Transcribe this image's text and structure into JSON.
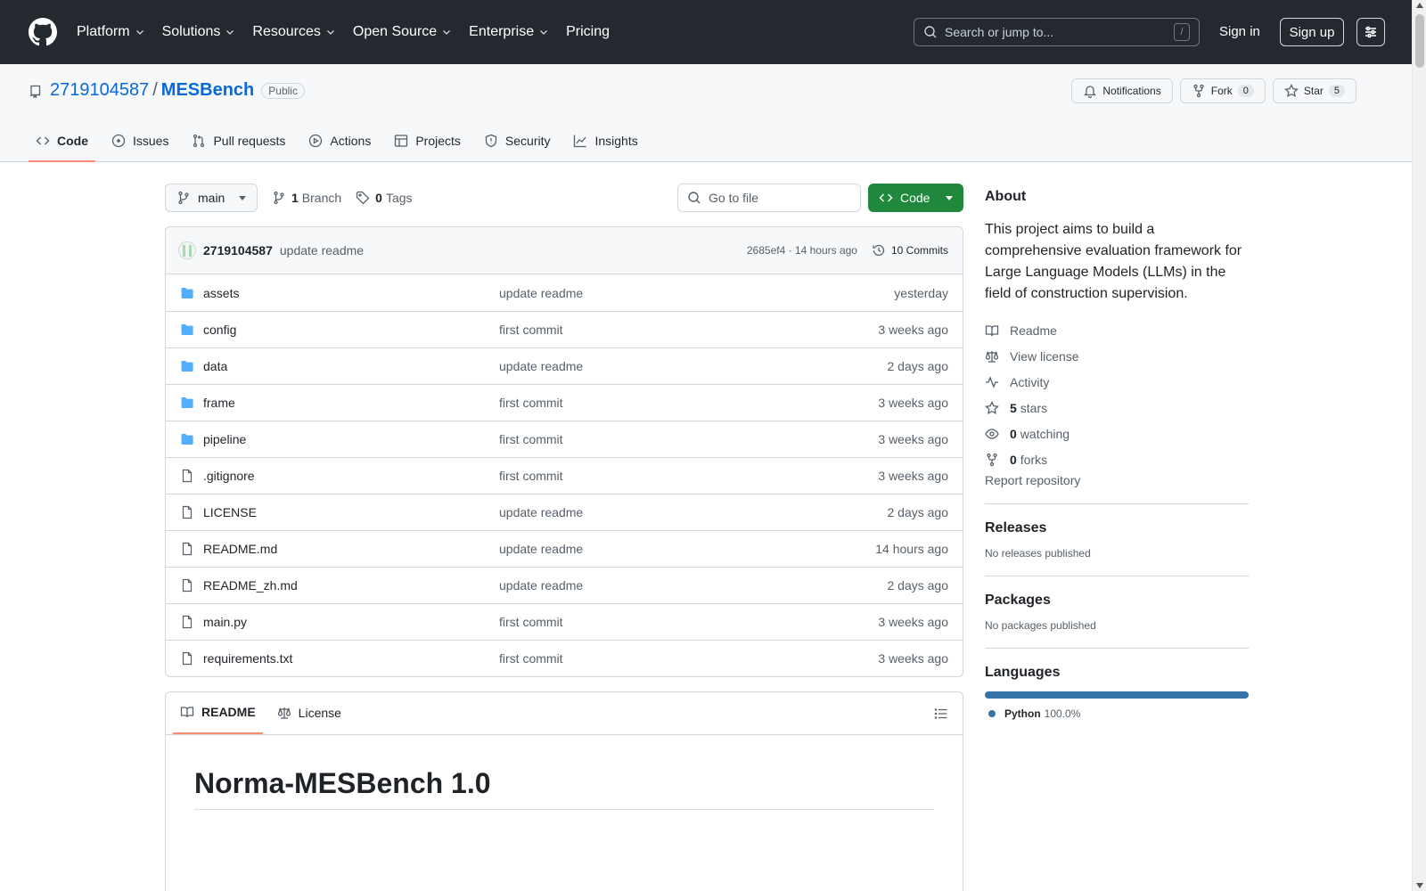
{
  "header": {
    "nav": [
      "Platform",
      "Solutions",
      "Resources",
      "Open Source",
      "Enterprise",
      "Pricing"
    ],
    "search_placeholder": "Search or jump to...",
    "search_shortcut": "/",
    "signin": "Sign in",
    "signup": "Sign up"
  },
  "repo": {
    "owner": "2719104587",
    "separator": "/",
    "name": "MESBench",
    "visibility": "Public",
    "notifications": "Notifications",
    "fork": "Fork",
    "fork_count": "0",
    "star": "Star",
    "star_count": "5",
    "tabs": [
      "Code",
      "Issues",
      "Pull requests",
      "Actions",
      "Projects",
      "Security",
      "Insights"
    ]
  },
  "toolbar": {
    "branch": "main",
    "branch_count": "1",
    "branch_label": "Branch",
    "tag_count": "0",
    "tag_label": "Tags",
    "goto_placeholder": "Go to file",
    "code_button": "Code"
  },
  "commit": {
    "author": "2719104587",
    "message": "update readme",
    "hash_time": "2685ef4 · 14 hours ago",
    "commits": "10 Commits"
  },
  "files": [
    {
      "name": "assets",
      "type": "dir",
      "message": "update readme",
      "date": "yesterday"
    },
    {
      "name": "config",
      "type": "dir",
      "message": "first commit",
      "date": "3 weeks ago"
    },
    {
      "name": "data",
      "type": "dir",
      "message": "update readme",
      "date": "2 days ago"
    },
    {
      "name": "frame",
      "type": "dir",
      "message": "first commit",
      "date": "3 weeks ago"
    },
    {
      "name": "pipeline",
      "type": "dir",
      "message": "first commit",
      "date": "3 weeks ago"
    },
    {
      "name": ".gitignore",
      "type": "file",
      "message": "first commit",
      "date": "3 weeks ago"
    },
    {
      "name": "LICENSE",
      "type": "file",
      "message": "update readme",
      "date": "2 days ago"
    },
    {
      "name": "README.md",
      "type": "file",
      "message": "update readme",
      "date": "14 hours ago"
    },
    {
      "name": "README_zh.md",
      "type": "file",
      "message": "update readme",
      "date": "2 days ago"
    },
    {
      "name": "main.py",
      "type": "file",
      "message": "first commit",
      "date": "3 weeks ago"
    },
    {
      "name": "requirements.txt",
      "type": "file",
      "message": "first commit",
      "date": "3 weeks ago"
    }
  ],
  "readme": {
    "tab_readme": "README",
    "tab_license": "License",
    "heading": "Norma-MESBench 1.0"
  },
  "about": {
    "title": "About",
    "description": "This project aims to build a comprehensive evaluation framework for Large Language Models (LLMs) in the field of construction supervision.",
    "readme": "Readme",
    "license": "View license",
    "activity": "Activity",
    "stars_count": "5",
    "stars_label": "stars",
    "watching_count": "0",
    "watching_label": "watching",
    "forks_count": "0",
    "forks_label": "forks",
    "report": "Report repository"
  },
  "releases": {
    "title": "Releases",
    "text": "No releases published"
  },
  "packages": {
    "title": "Packages",
    "text": "No packages published"
  },
  "languages": {
    "title": "Languages",
    "name": "Python",
    "percent": "100.0%",
    "color": "#3572A5",
    "share": 1.0
  },
  "colors": {
    "header_bg": "#24292f",
    "link": "#0969da",
    "green": "#1f883d",
    "tab_underline": "#fd8c73"
  }
}
